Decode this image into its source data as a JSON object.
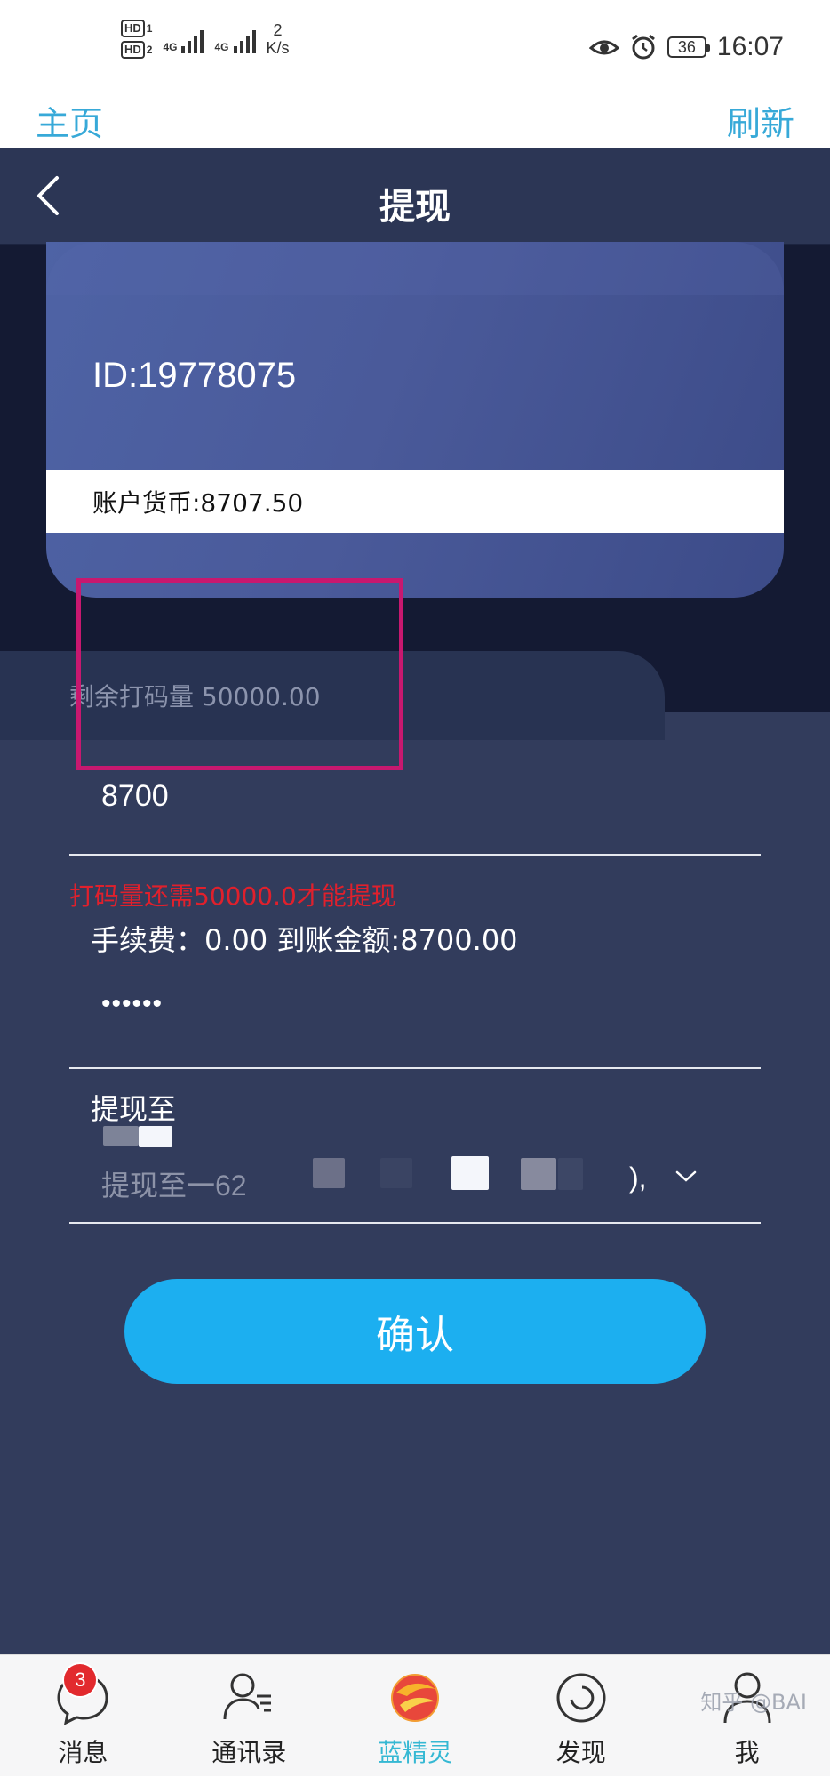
{
  "status_bar": {
    "sim1": "HD",
    "sim1_index": "1",
    "sim2": "HD",
    "sim2_index": "2",
    "net1": "4G",
    "net2": "4G",
    "speed_value": "2",
    "speed_unit": "K/s",
    "battery": "36",
    "time": "16:07",
    "icons": [
      "eye-icon",
      "alarm-icon",
      "battery-icon"
    ]
  },
  "top_links": {
    "home": "主页",
    "refresh": "刷新"
  },
  "header": {
    "title": "提现",
    "back_icon": "chevron-left-icon"
  },
  "account_card": {
    "id_text": "ID:19778075",
    "balance_text": "账户货币:8707.50"
  },
  "remaining_bet": {
    "text": "剩余打码量 50000.00"
  },
  "form": {
    "amount_value": "8700",
    "error_text": "打码量还需50000.0才能提现",
    "fee_text": "手续费：0.00   到账金额:8700.00",
    "password_value": "••••••",
    "withdraw_to_label": "提现至",
    "withdraw_to_value": "提现至一62",
    "withdraw_to_tail": "),"
  },
  "confirm_button": "确认",
  "tabs": [
    {
      "label": "消息",
      "icon": "message-icon",
      "badge": "3",
      "active": false
    },
    {
      "label": "通讯录",
      "icon": "contacts-icon",
      "active": false
    },
    {
      "label": "蓝精灵",
      "icon": "app-logo-icon",
      "active": true
    },
    {
      "label": "发现",
      "icon": "discover-icon",
      "active": false
    },
    {
      "label": "我",
      "icon": "profile-icon",
      "active": false
    }
  ],
  "watermark": "知乎 @BAI",
  "colors": {
    "accent": "#1caff0",
    "header_bg": "#2c3655",
    "page_bg": "#323c5c",
    "error": "#e0202c",
    "highlight": "#c8186f",
    "active_tab": "#35b8d3"
  }
}
